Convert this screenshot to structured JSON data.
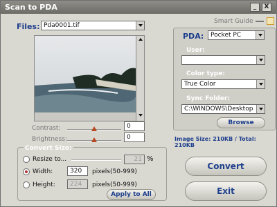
{
  "window": {
    "title": "Scan to PDA"
  },
  "titlebar": {
    "minimize": "_",
    "close": "X"
  },
  "files": {
    "label": "Files:",
    "value": "Pda0001.tif"
  },
  "smart_guide": {
    "label": "Smart Guide"
  },
  "pda": {
    "label": "PDA:",
    "value": "Pocket PC"
  },
  "user": {
    "label": "User:",
    "value": ""
  },
  "color_type": {
    "label": "Color type:",
    "value": "True Color"
  },
  "sync_folder": {
    "label": "Sync Folder:",
    "value": "C:\\WINDOWS\\Desktop"
  },
  "browse": {
    "label": "Browse"
  },
  "image_size": {
    "text": "Image Size: 210KB / Total: 210KB"
  },
  "adjust": {
    "contrast_label": "Contrast:",
    "contrast_value": "0",
    "brightness_label": "Brightness:",
    "brightness_value": "0",
    "contrast_level": 0.5,
    "brightness_level": 0.5
  },
  "convert_size": {
    "title": "Convert Size:",
    "resize_label": "Resize to...",
    "resize_value": "21",
    "percent": "%",
    "width_label": "Width:",
    "width_value": "320",
    "width_unit": "pixels(50-999)",
    "height_label": "Height:",
    "height_value": "224",
    "height_unit": "pixels(50-999)",
    "apply_all": "Apply to All"
  },
  "actions": {
    "convert": "Convert",
    "exit": "Exit"
  }
}
